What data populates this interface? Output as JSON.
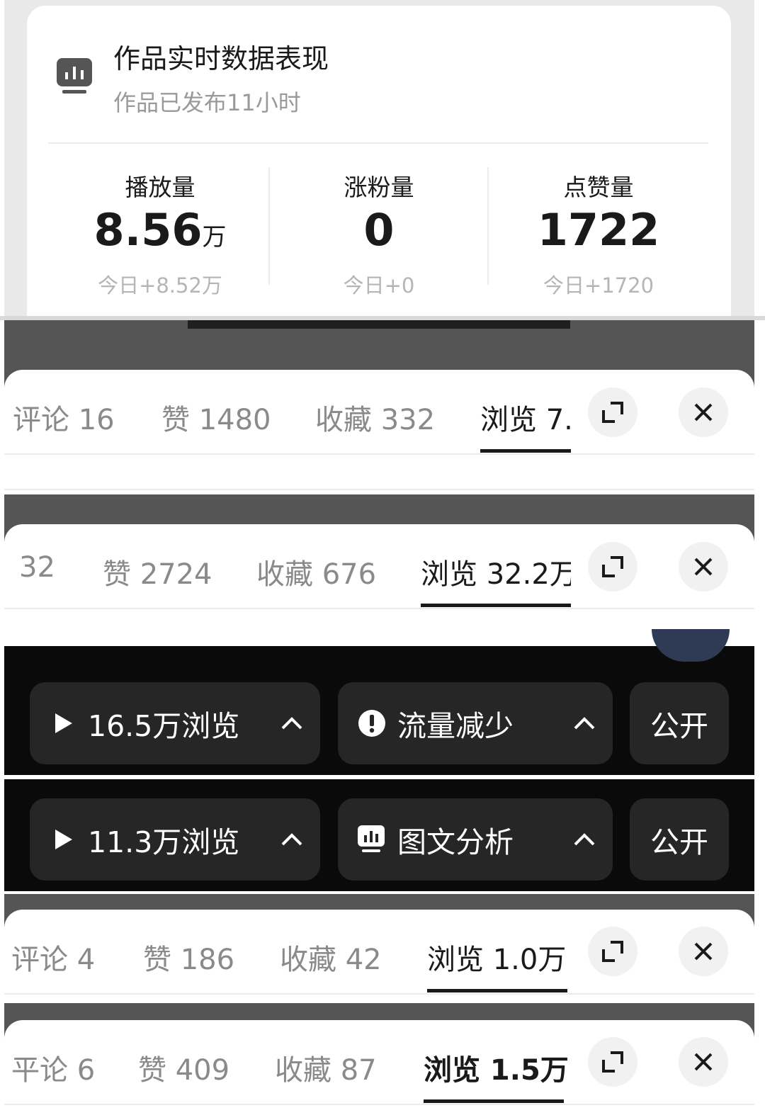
{
  "stats_card": {
    "title": "作品实时数据表现",
    "subtitle": "作品已发布11小时",
    "stats": [
      {
        "label": "播放量",
        "value": "8.56",
        "unit": "万",
        "today": "今日+8.52万"
      },
      {
        "label": "涨粉量",
        "value": "0",
        "unit": "",
        "today": "今日+0"
      },
      {
        "label": "点赞量",
        "value": "1722",
        "unit": "",
        "today": "今日+1720"
      }
    ]
  },
  "tabbar_1": {
    "tabs": [
      "评论 16",
      "赞 1480",
      "收藏 332",
      "浏览 7."
    ],
    "active_index": 3
  },
  "tabbar_2": {
    "tabs": [
      "32",
      "赞 2724",
      "收藏 676",
      "浏览 32.2万"
    ],
    "active_index": 3
  },
  "buttons_row_1": {
    "views": "16.5万浏览",
    "status": "流量减少",
    "visibility": "公开"
  },
  "buttons_row_2": {
    "views": "11.3万浏览",
    "analysis": "图文分析",
    "visibility": "公开"
  },
  "tabbar_3": {
    "tabs": [
      "评论 4",
      "赞 186",
      "收藏 42",
      "浏览 1.0万"
    ],
    "active_index": 3
  },
  "tabbar_4": {
    "tabs": [
      "平论 6",
      "赞 409",
      "收藏 87",
      "浏览 1.5万"
    ],
    "active_index": 3
  },
  "icons": {
    "expand": "expand-icon",
    "close": "close-icon",
    "play": "play-icon",
    "chevron": "chevron-up-icon",
    "alert": "alert-icon",
    "analytics": "analytics-icon"
  }
}
